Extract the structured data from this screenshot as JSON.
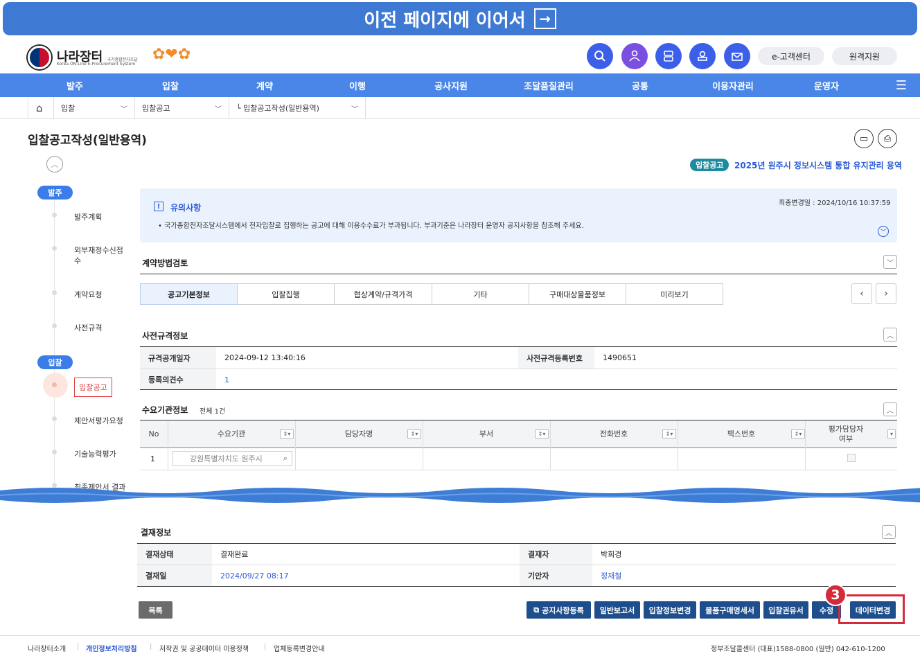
{
  "banner": {
    "text": "이전 페이지에 이어서",
    "arrow_icon": "→"
  },
  "header": {
    "logo_text": "나라장터",
    "logo_sub_kr": "국가종합전자조달",
    "logo_sub_en": "Korea ON-Line E-Procurement System",
    "buttons": [
      "e-고객센터",
      "원격지원"
    ]
  },
  "nav": [
    "발주",
    "입찰",
    "계약",
    "이행",
    "공사지원",
    "조달품질관리",
    "공통",
    "이용자관리",
    "운영자"
  ],
  "breadcrumb": [
    "입찰",
    "입찰공고",
    "└ 입찰공고작성(일반용역)"
  ],
  "page": {
    "title": "입찰공고작성(일반용역)",
    "tag": "입찰공고",
    "bid_title": "2025년 원주시 정보시스템 통합 유지관리 용역"
  },
  "sidebar": {
    "groups": [
      {
        "label": "발주",
        "items": [
          "발주계획",
          "외부재정수신접수",
          "계약요청",
          "사전규격"
        ]
      },
      {
        "label": "입찰",
        "items": [
          "입찰공고",
          "제안서평가요청",
          "기술능력평가",
          "최종제안서 결과"
        ]
      }
    ]
  },
  "notice": {
    "title": "유의사항",
    "icon": "!",
    "last_modified": "최종변경일 : 2024/10/16 10:37:59",
    "text": "• 국가종합전자조달시스템에서 전자입찰로 집행하는 공고에 대해 이용수수료가 부과됩니다. 부과기준은 나라장터 운영자 공지사항을 참조해 주세요."
  },
  "sections": {
    "contract_review": "계약방법검토",
    "pre_spec": "사전규격정보",
    "demand_org": "수요기관정보",
    "demand_count": "전체 1건",
    "approval": "결재정보"
  },
  "tabs": [
    "공고기본정보",
    "입찰집행",
    "협상계약/규격가격",
    "기타",
    "구매대상물품정보",
    "미리보기"
  ],
  "pre_spec": {
    "open_date_label": "규격공개일자",
    "open_date": "2024-09-12 13:40:16",
    "reg_no_label": "사전규격등록번호",
    "reg_no": "1490651",
    "opinion_label": "등록의견수",
    "opinion_count": "1"
  },
  "demand_table": {
    "headers": [
      "No",
      "수요기관",
      "담당자명",
      "부서",
      "전화번호",
      "팩스번호",
      "평가담당자 여부"
    ],
    "rows": [
      {
        "no": "1",
        "org": "강원특별자치도 원주시"
      }
    ]
  },
  "approval": {
    "status_label": "결재상태",
    "status": "결재완료",
    "approver_label": "결재자",
    "approver": "박희경",
    "date_label": "결재일",
    "date": "2024/09/27 08:17",
    "drafter_label": "기안자",
    "drafter": "정재철"
  },
  "actions": {
    "list": "목록",
    "buttons": [
      "공지사항등록",
      "일반보고서",
      "입찰정보변경",
      "물품구매명세서",
      "입찰권유서",
      "수정",
      "데이터변경"
    ],
    "step_badge": "3"
  },
  "footer": {
    "links": [
      "나라장터소개",
      "개인정보처리방침",
      "저작권 및 공공데이터 이용정책",
      "업체등록변경안내"
    ],
    "contact": "정부조달콜센터 (대표)1588-0800 (일반) 042-610-1200"
  },
  "colors": {
    "primary": "#4a86e8",
    "accent": "#2b5bd7",
    "highlight": "#d42a3a"
  }
}
